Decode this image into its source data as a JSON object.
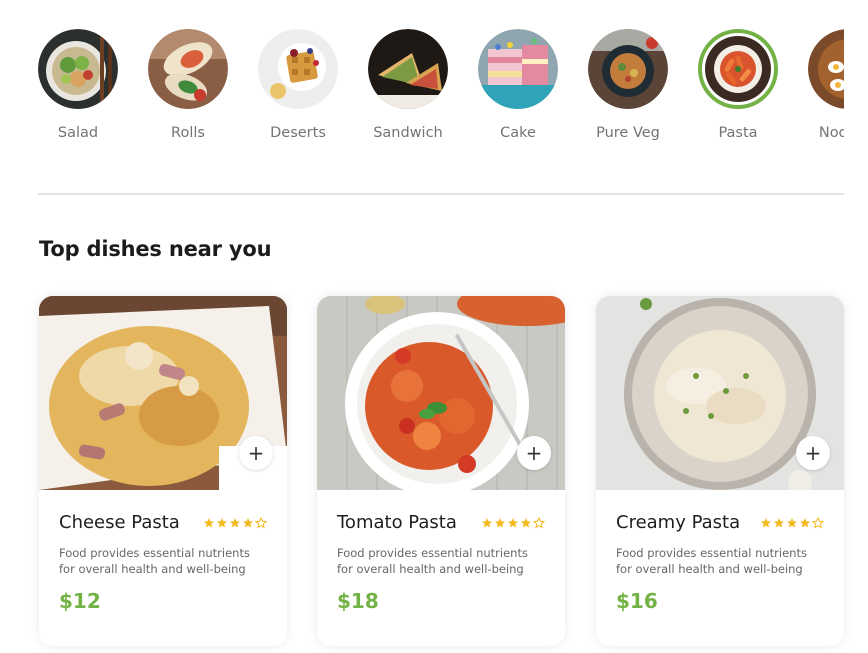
{
  "categories": [
    {
      "label": "Salad",
      "active": false
    },
    {
      "label": "Rolls",
      "active": false
    },
    {
      "label": "Deserts",
      "active": false
    },
    {
      "label": "Sandwich",
      "active": false
    },
    {
      "label": "Cake",
      "active": false
    },
    {
      "label": "Pure Veg",
      "active": false
    },
    {
      "label": "Pasta",
      "active": true
    },
    {
      "label": "Noodles",
      "active": false
    }
  ],
  "section_title": "Top dishes near you",
  "dishes": [
    {
      "name": "Cheese Pasta",
      "rating": 4,
      "rating_max": 5,
      "description": "Food provides essential nutrients for overall health and well-being",
      "price": "$12",
      "add_label": "+"
    },
    {
      "name": "Tomato Pasta",
      "rating": 4,
      "rating_max": 5,
      "description": "Food provides essential nutrients for overall health and well-being",
      "price": "$18",
      "add_label": "+"
    },
    {
      "name": "Creamy Pasta",
      "rating": 4,
      "rating_max": 5,
      "description": "Food provides essential nutrients for overall health and well-being",
      "price": "$16",
      "add_label": "+"
    }
  ],
  "colors": {
    "accent": "#73b245",
    "star": "#f5b921",
    "divider": "#e2e2e2"
  }
}
